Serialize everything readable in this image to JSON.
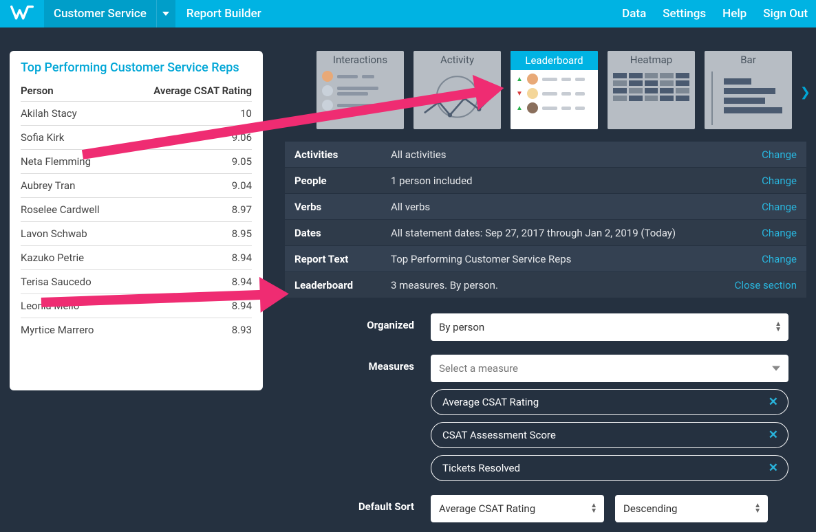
{
  "topnav": {
    "module": "Customer Service",
    "builder": "Report Builder",
    "links": [
      "Data",
      "Settings",
      "Help",
      "Sign Out"
    ]
  },
  "preview": {
    "title": "Top Performing Customer Service Reps",
    "col_person": "Person",
    "col_rating": "Average CSAT Rating",
    "rows": [
      {
        "name": "Akilah Stacy",
        "val": "10"
      },
      {
        "name": "Sofia Kirk",
        "val": "9.06"
      },
      {
        "name": "Neta Flemming",
        "val": "9.05"
      },
      {
        "name": "Aubrey Tran",
        "val": "9.04"
      },
      {
        "name": "Roselee Cardwell",
        "val": "8.97"
      },
      {
        "name": "Lavon Schwab",
        "val": "8.95"
      },
      {
        "name": "Kazuko Petrie",
        "val": "8.94"
      },
      {
        "name": "Terisa Saucedo",
        "val": "8.94"
      },
      {
        "name": "Leonia Mello",
        "val": "8.94"
      },
      {
        "name": "Myrtice Marrero",
        "val": "8.93"
      }
    ]
  },
  "viz": {
    "options": [
      "Interactions",
      "Activity",
      "Leaderboard",
      "Heatmap",
      "Bar"
    ],
    "selected": "Leaderboard"
  },
  "settings": {
    "rows": [
      {
        "label": "Activities",
        "value": "All activities",
        "action": "Change"
      },
      {
        "label": "People",
        "value": "1 person included",
        "action": "Change"
      },
      {
        "label": "Verbs",
        "value": "All verbs",
        "action": "Change"
      },
      {
        "label": "Dates",
        "value": "All statement dates: Sep 27, 2017 through Jan 2, 2019 (Today)",
        "action": "Change"
      },
      {
        "label": "Report Text",
        "value": "Top Performing Customer Service Reps",
        "action": "Change"
      },
      {
        "label": "Leaderboard",
        "value": "3 measures. By person.",
        "action": "Close section"
      }
    ]
  },
  "expanded": {
    "organized_label": "Organized",
    "organized_value": "By person",
    "measures_label": "Measures",
    "measures_placeholder": "Select a measure",
    "measures": [
      "Average CSAT Rating",
      "CSAT Assessment Score",
      "Tickets Resolved"
    ],
    "sort_label": "Default Sort",
    "sort_field": "Average CSAT Rating",
    "sort_dir": "Descending"
  },
  "chart_data": {
    "type": "table",
    "title": "Top Performing Customer Service Reps",
    "columns": [
      "Person",
      "Average CSAT Rating"
    ],
    "categories": [
      "Akilah Stacy",
      "Sofia Kirk",
      "Neta Flemming",
      "Aubrey Tran",
      "Roselee Cardwell",
      "Lavon Schwab",
      "Kazuko Petrie",
      "Terisa Saucedo",
      "Leonia Mello",
      "Myrtice Marrero"
    ],
    "values": [
      10,
      9.06,
      9.05,
      9.04,
      8.97,
      8.95,
      8.94,
      8.94,
      8.94,
      8.93
    ],
    "ylabel": "Average CSAT Rating"
  }
}
